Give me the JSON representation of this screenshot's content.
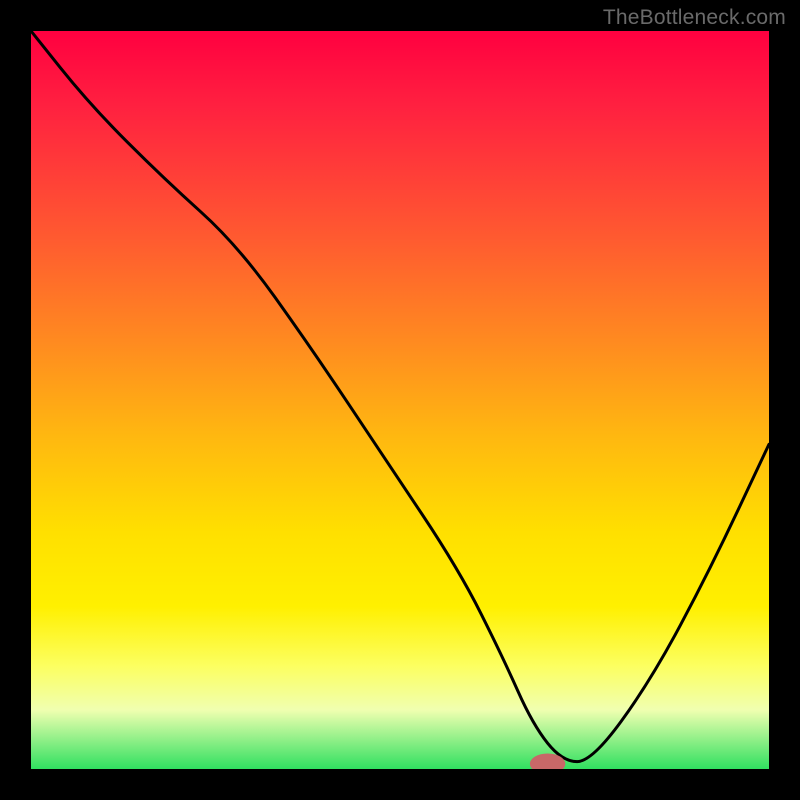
{
  "watermark": "TheBottleneck.com",
  "chart_data": {
    "type": "line",
    "title": "",
    "xlabel": "",
    "ylabel": "",
    "xlim": [
      0,
      100
    ],
    "ylim": [
      0,
      100
    ],
    "series": [
      {
        "name": "curve",
        "x": [
          0,
          8,
          18,
          28,
          38,
          48,
          58,
          64,
          68,
          72,
          76,
          84,
          92,
          100
        ],
        "y": [
          100,
          90,
          80,
          71,
          57,
          42,
          27,
          15,
          6,
          1,
          1,
          12,
          27,
          44
        ]
      }
    ],
    "marker": {
      "x": 70,
      "y": 0.7,
      "rx": 2.4,
      "ry": 1.4,
      "color": "#c86868"
    }
  }
}
